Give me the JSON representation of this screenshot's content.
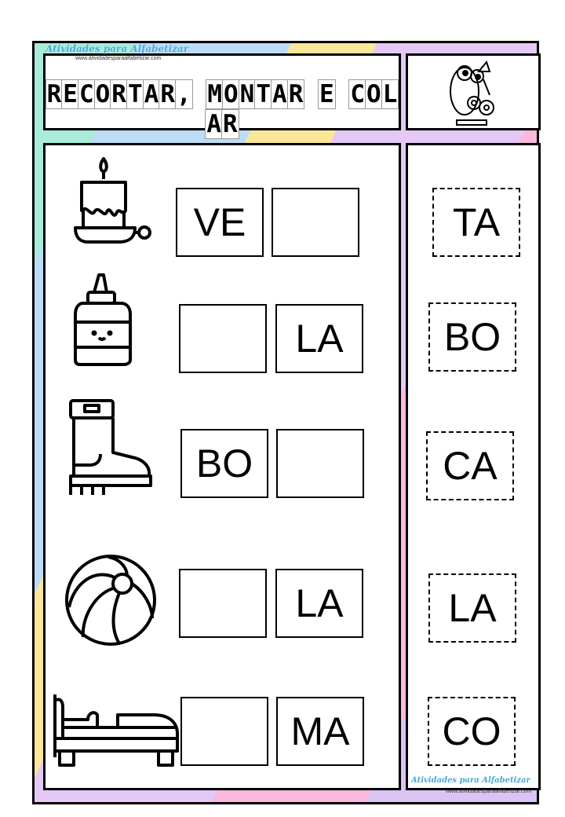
{
  "header": {
    "title": "RECORTAR, MONTAR E COLAR",
    "logo_text": "Atividades para Alfabetizar",
    "logo_url": "www.atividadesparaalfabetizar.com"
  },
  "rows": [
    {
      "picture": "candle-icon",
      "syllables": [
        "VE",
        ""
      ]
    },
    {
      "picture": "glue-bottle-icon",
      "syllables": [
        "",
        "LA"
      ]
    },
    {
      "picture": "boot-icon",
      "syllables": [
        "BO",
        ""
      ]
    },
    {
      "picture": "ball-icon",
      "syllables": [
        "",
        "LA"
      ]
    },
    {
      "picture": "bed-icon",
      "syllables": [
        "",
        "MA"
      ]
    }
  ],
  "cutouts": [
    "TA",
    "BO",
    "CA",
    "LA",
    "CO"
  ],
  "footer": {
    "logo_text": "Atividades para Alfabetizar",
    "logo_url": "www.atividadesparaalfabetizar.com"
  }
}
